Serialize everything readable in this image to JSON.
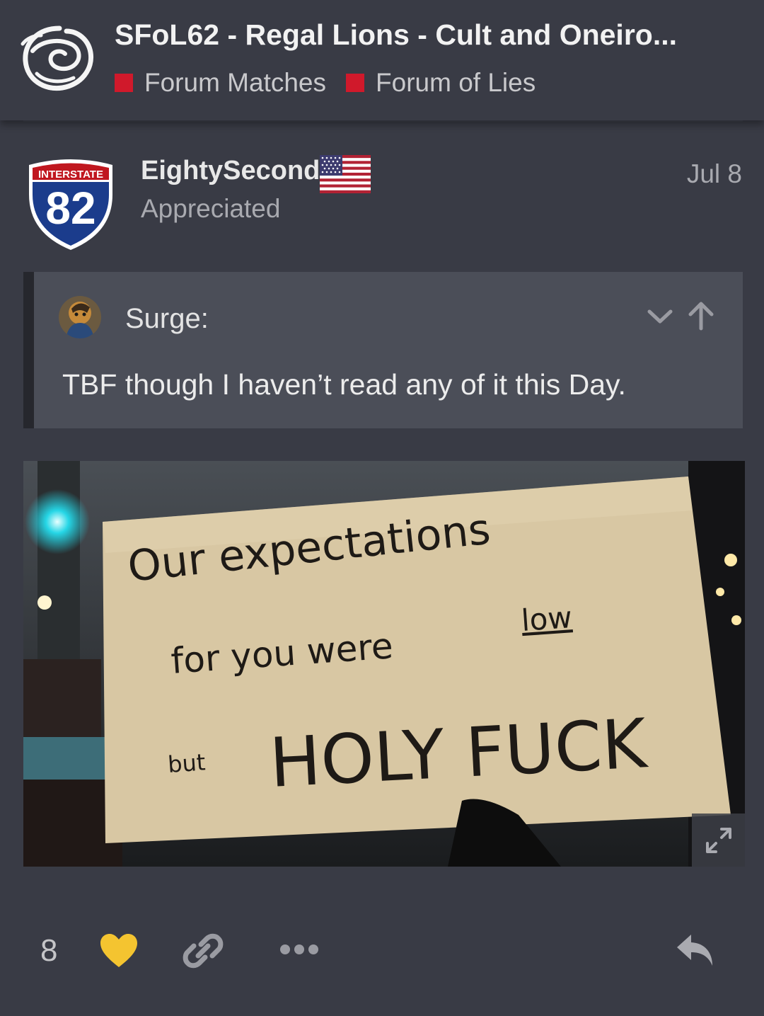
{
  "topic": {
    "title": "SFoL62 - Regal Lions - Cult and Oneiro...",
    "categories": [
      {
        "name": "Forum Matches",
        "color": "#d0192b"
      },
      {
        "name": "Forum of Lies",
        "color": "#d0192b"
      }
    ]
  },
  "post": {
    "username": "EightySecond",
    "user_title": "Appreciated",
    "date": "Jul 8",
    "avatar_badge": {
      "top": "INTERSTATE",
      "number": "82"
    },
    "flag_icon": "us-flag-icon",
    "quote": {
      "username": "Surge:",
      "text": "TBF though I haven’t read any of it this Day."
    },
    "image": {
      "sign_lines": [
        "Our expectations",
        "for you were",
        "low",
        "but",
        "HOLY FUCK"
      ]
    },
    "actions": {
      "like_count": "8",
      "icons": [
        "heart-icon",
        "link-icon",
        "more-icon",
        "reply-icon"
      ]
    }
  },
  "colors": {
    "background": "#393b45",
    "quote_bg": "#4b4e58",
    "heart": "#f4c430",
    "category": "#d0192b"
  }
}
